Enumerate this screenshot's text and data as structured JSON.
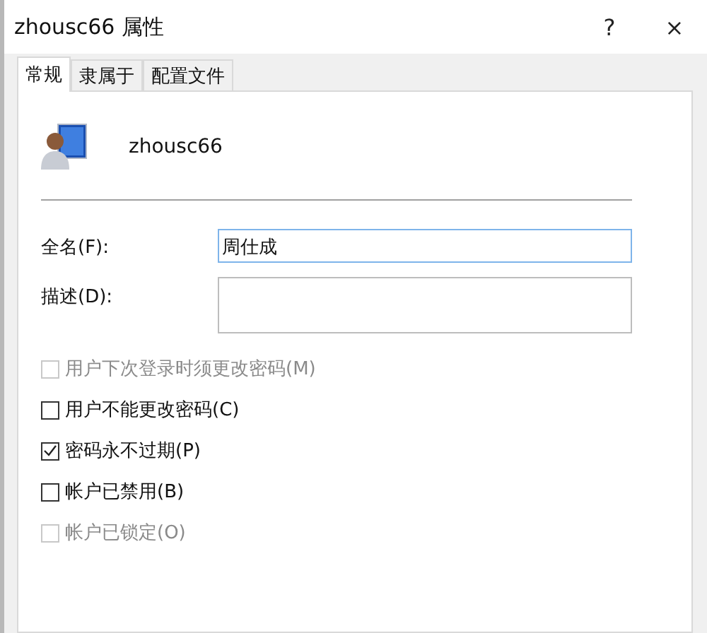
{
  "window": {
    "title": "zhousc66 属性",
    "help": "?",
    "close": "×"
  },
  "tabs": [
    {
      "label": "常规",
      "selected": true
    },
    {
      "label": "隶属于",
      "selected": false
    },
    {
      "label": "配置文件",
      "selected": false
    }
  ],
  "user": {
    "name": "zhousc66"
  },
  "fields": [
    {
      "label": "全名(F):",
      "value": "周仕成",
      "kind": "line",
      "focused": true
    },
    {
      "label": "描述(D):",
      "kind": "area",
      "focused": false
    }
  ],
  "options": [
    {
      "label": "用户下次登录时须更改密码(M)",
      "checked": false,
      "disabled": true
    },
    {
      "label": "用户不能更改密码(C)",
      "checked": false,
      "disabled": false
    },
    {
      "label": "密码永不过期(P)",
      "checked": true,
      "disabled": false
    },
    {
      "label": "帐户已禁用(B)",
      "checked": false,
      "disabled": false
    },
    {
      "label": "帐户已锁定(O)",
      "checked": false,
      "disabled": true
    }
  ]
}
